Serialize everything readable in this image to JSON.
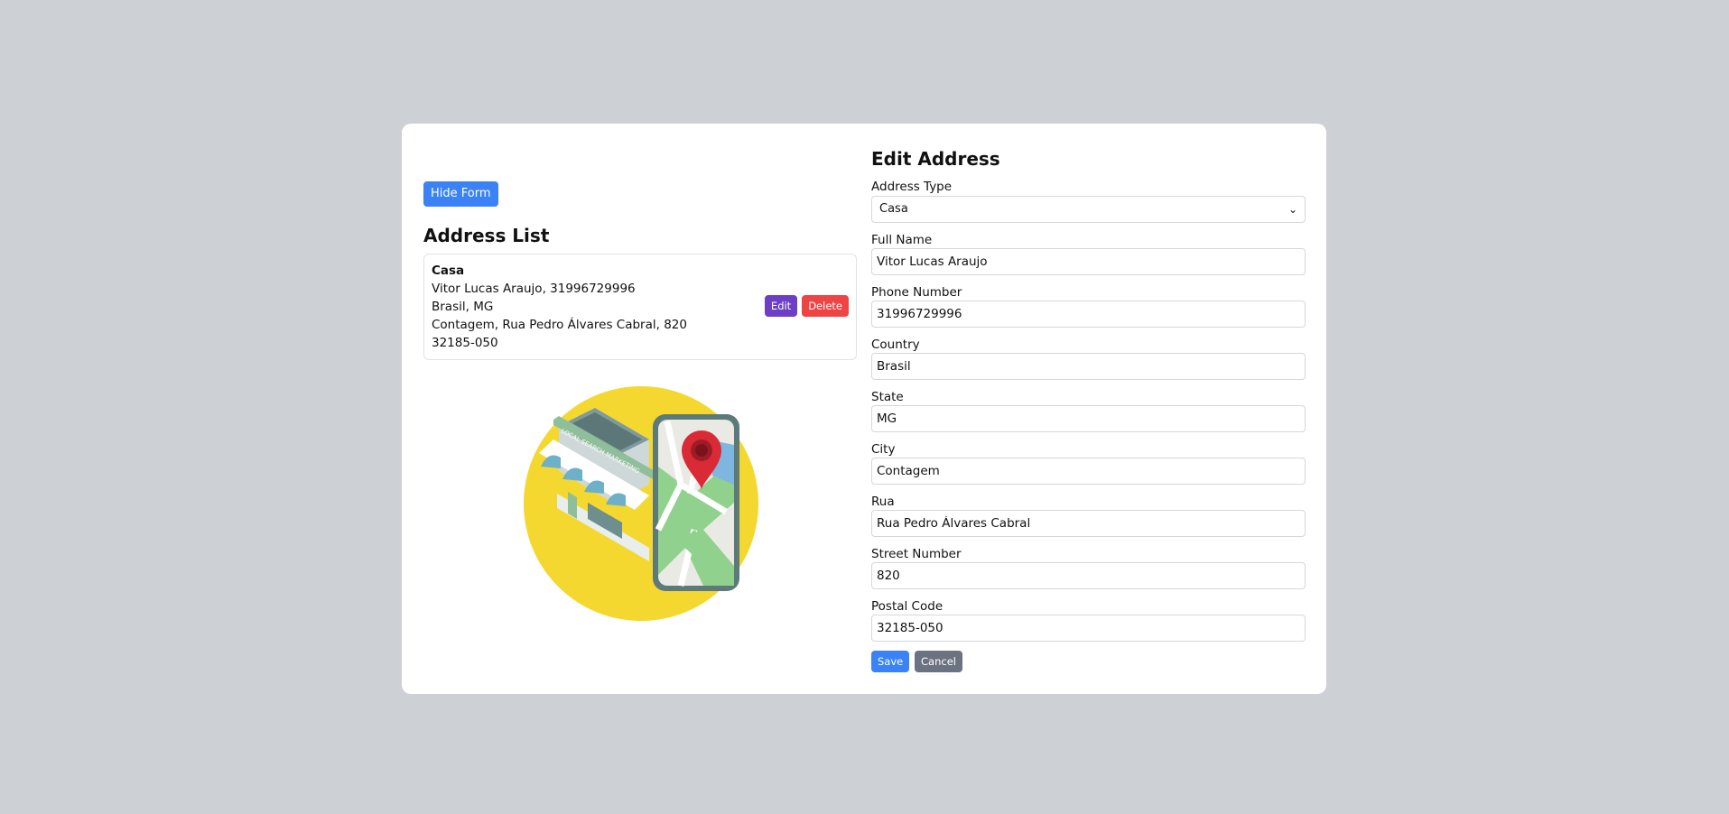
{
  "left": {
    "hide_form_label": "Hide Form",
    "list_title": "Address List",
    "address": {
      "type": "Casa",
      "name_phone": "Vitor Lucas Araujo, 31996729996",
      "country_state": "Brasil, MG",
      "city_street": "Contagem, Rua Pedro Álvares Cabral, 820",
      "postal": "32185-050",
      "edit_label": "Edit",
      "delete_label": "Delete"
    },
    "illustration": {
      "sign_text": "LOCAL SEARCH MARKETING",
      "icon": "store-map-pin-illustration"
    }
  },
  "form": {
    "title": "Edit Address",
    "address_type": {
      "label": "Address Type",
      "value": "Casa"
    },
    "full_name": {
      "label": "Full Name",
      "value": "Vitor Lucas Araujo"
    },
    "phone": {
      "label": "Phone Number",
      "value": "31996729996"
    },
    "country": {
      "label": "Country",
      "value": "Brasil"
    },
    "state": {
      "label": "State",
      "value": "MG"
    },
    "city": {
      "label": "City",
      "value": "Contagem"
    },
    "street": {
      "label": "Rua",
      "value": "Rua Pedro Álvares Cabral"
    },
    "number": {
      "label": "Street Number",
      "value": "820"
    },
    "postal": {
      "label": "Postal Code",
      "value": "32185-050"
    },
    "save_label": "Save",
    "cancel_label": "Cancel"
  },
  "colors": {
    "primary": "#3b82f6",
    "edit": "#6d3fc7",
    "danger": "#ef4444",
    "secondary": "#6b7280",
    "illustration_circle": "#f4d830"
  }
}
